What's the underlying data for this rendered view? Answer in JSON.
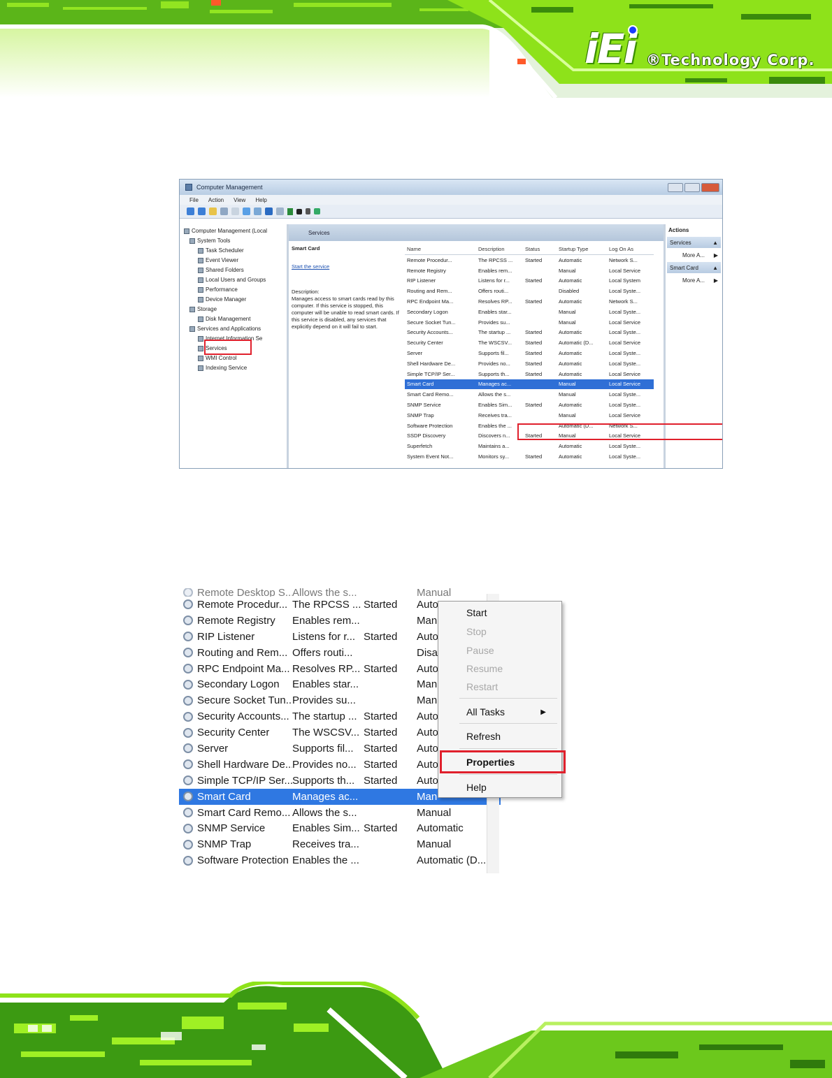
{
  "brand": {
    "mark": "iEi",
    "text": "®Technology Corp."
  },
  "colors": {
    "accent_green": "#8ee21a",
    "highlight_red": "#e0202c",
    "selection_blue": "#2f6fd6"
  },
  "computer_management": {
    "title": "Computer Management",
    "menu": [
      "File",
      "Action",
      "View",
      "Help"
    ],
    "tree": [
      "Computer Management (Local",
      "System Tools",
      "Task Scheduler",
      "Event Viewer",
      "Shared Folders",
      "Local Users and Groups",
      "Performance",
      "Device Manager",
      "Storage",
      "Disk Management",
      "Services and Applications",
      "Internet Information Se",
      "Services",
      "WMI Control",
      "Indexing Service"
    ],
    "center_header": "Services",
    "selected_service": "Smart Card",
    "start_link": "Start the service",
    "description_label": "Description:",
    "description": "Manages access to smart cards read by this computer. If this service is stopped, this computer will be unable to read smart cards. If this service is disabled, any services that explicitly depend on it will fail to start.",
    "columns": [
      "Name",
      "Description",
      "Status",
      "Startup Type",
      "Log On As"
    ],
    "rows": [
      [
        "Remote Procedur...",
        "The RPCSS ...",
        "Started",
        "Automatic",
        "Network S..."
      ],
      [
        "Remote Registry",
        "Enables rem...",
        "",
        "Manual",
        "Local Service"
      ],
      [
        "RIP Listener",
        "Listens for r...",
        "Started",
        "Automatic",
        "Local System"
      ],
      [
        "Routing and Rem...",
        "Offers routi...",
        "",
        "Disabled",
        "Local Syste..."
      ],
      [
        "RPC Endpoint Ma...",
        "Resolves RP...",
        "Started",
        "Automatic",
        "Network S..."
      ],
      [
        "Secondary Logon",
        "Enables star...",
        "",
        "Manual",
        "Local Syste..."
      ],
      [
        "Secure Socket Tun...",
        "Provides su...",
        "",
        "Manual",
        "Local Service"
      ],
      [
        "Security Accounts...",
        "The startup ...",
        "Started",
        "Automatic",
        "Local Syste..."
      ],
      [
        "Security Center",
        "The WSCSV...",
        "Started",
        "Automatic (D...",
        "Local Service"
      ],
      [
        "Server",
        "Supports fil...",
        "Started",
        "Automatic",
        "Local Syste..."
      ],
      [
        "Shell Hardware De...",
        "Provides no...",
        "Started",
        "Automatic",
        "Local Syste..."
      ],
      [
        "Simple TCP/IP Ser...",
        "Supports th...",
        "Started",
        "Automatic",
        "Local Service"
      ],
      [
        "Smart Card",
        "Manages ac...",
        "",
        "Manual",
        "Local Service"
      ],
      [
        "Smart Card Remo...",
        "Allows the s...",
        "",
        "Manual",
        "Local Syste..."
      ],
      [
        "SNMP Service",
        "Enables Sim...",
        "Started",
        "Automatic",
        "Local Syste..."
      ],
      [
        "SNMP Trap",
        "Receives tra...",
        "",
        "Manual",
        "Local Service"
      ],
      [
        "Software Protection",
        "Enables the ...",
        "",
        "Automatic (D...",
        "Network S..."
      ],
      [
        "SSDP Discovery",
        "Discovers n...",
        "Started",
        "Manual",
        "Local Service"
      ],
      [
        "Superfetch",
        "Maintains a...",
        "",
        "Automatic",
        "Local Syste..."
      ],
      [
        "System Event Not...",
        "Monitors sy...",
        "Started",
        "Automatic",
        "Local Syste..."
      ]
    ],
    "actions_header": "Actions",
    "actions": [
      {
        "section": "Services",
        "item": "More A..."
      },
      {
        "section": "Smart Card",
        "item": "More A..."
      }
    ]
  },
  "context_shot": {
    "top_cut_row": [
      "Remote Desktop S...",
      "Allows the s...",
      "",
      "Manual"
    ],
    "rows": [
      [
        "Remote Procedur...",
        "The RPCSS ...",
        "Started",
        "Auto"
      ],
      [
        "Remote Registry",
        "Enables rem...",
        "",
        "Man"
      ],
      [
        "RIP Listener",
        "Listens for r...",
        "Started",
        "Auto"
      ],
      [
        "Routing and Rem...",
        "Offers routi...",
        "",
        "Disa"
      ],
      [
        "RPC Endpoint Ma...",
        "Resolves RP...",
        "Started",
        "Auto"
      ],
      [
        "Secondary Logon",
        "Enables star...",
        "",
        "Man"
      ],
      [
        "Secure Socket Tun...",
        "Provides su...",
        "",
        "Man"
      ],
      [
        "Security Accounts...",
        "The startup ...",
        "Started",
        "Auto"
      ],
      [
        "Security Center",
        "The WSCSV...",
        "Started",
        "Auto"
      ],
      [
        "Server",
        "Supports fil...",
        "Started",
        "Auto"
      ],
      [
        "Shell Hardware De...",
        "Provides no...",
        "Started",
        "Auto"
      ],
      [
        "Simple TCP/IP Ser...",
        "Supports th...",
        "Started",
        "Auto"
      ],
      [
        "Smart Card",
        "Manages ac...",
        "",
        "Man"
      ],
      [
        "Smart Card Remo...",
        "Allows the s...",
        "",
        "Manual"
      ],
      [
        "SNMP Service",
        "Enables Sim...",
        "Started",
        "Automatic"
      ],
      [
        "SNMP Trap",
        "Receives tra...",
        "",
        "Manual"
      ],
      [
        "Software Protection",
        "Enables the ...",
        "",
        "Automatic (D..."
      ]
    ],
    "menu": {
      "start": "Start",
      "stop": "Stop",
      "pause": "Pause",
      "resume": "Resume",
      "restart": "Restart",
      "all_tasks": "All Tasks",
      "refresh": "Refresh",
      "properties": "Properties",
      "help": "Help"
    }
  }
}
